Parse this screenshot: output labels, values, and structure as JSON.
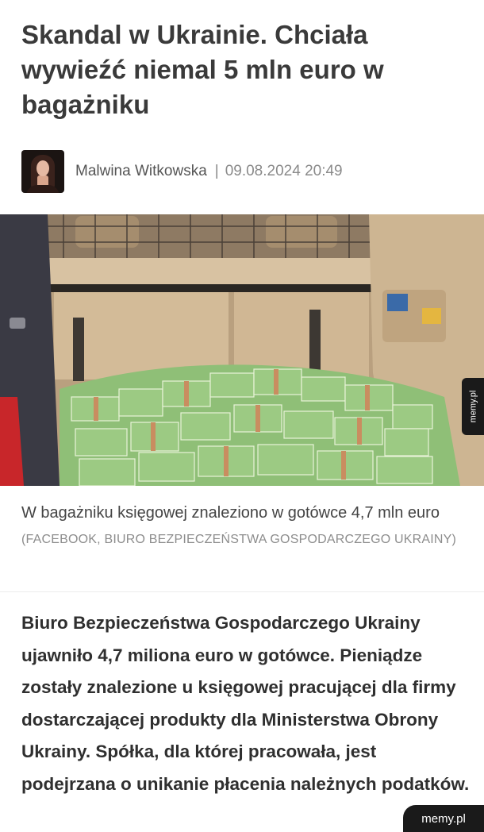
{
  "article": {
    "title": "Skandal w Ukrainie. Chciała wywieźć niemal 5 mln euro w bagażniku",
    "author": "Malwina Witkowska",
    "separator": "|",
    "datetime": "09.08.2024 20:49",
    "image_caption": "W bagażniku księgowej znaleziono w gotówce 4,7 mln euro",
    "image_source": "(FACEBOOK, BIURO BEZPIECZEŃSTWA GOSPODARCZEGO UKRAINY)",
    "lead": "Biuro Bezpieczeństwa Gospodarczego Ukrainy ujawniło 4,7 miliona euro w gotówce. Pieniądze zostały znalezione u księgowej pracującej dla firmy dostarczającej produkty dla Ministerstwa Obrony Ukrainy. Spółka, dla której pracowała, jest podejrzana o unikanie płacenia należnych podatków."
  },
  "watermark": {
    "side": "memy.pl",
    "bottom": "memy.pl"
  },
  "colors": {
    "money_green": "#7fb56a",
    "trunk_beige": "#c9b08f",
    "text_dark": "#3a3a3a"
  }
}
